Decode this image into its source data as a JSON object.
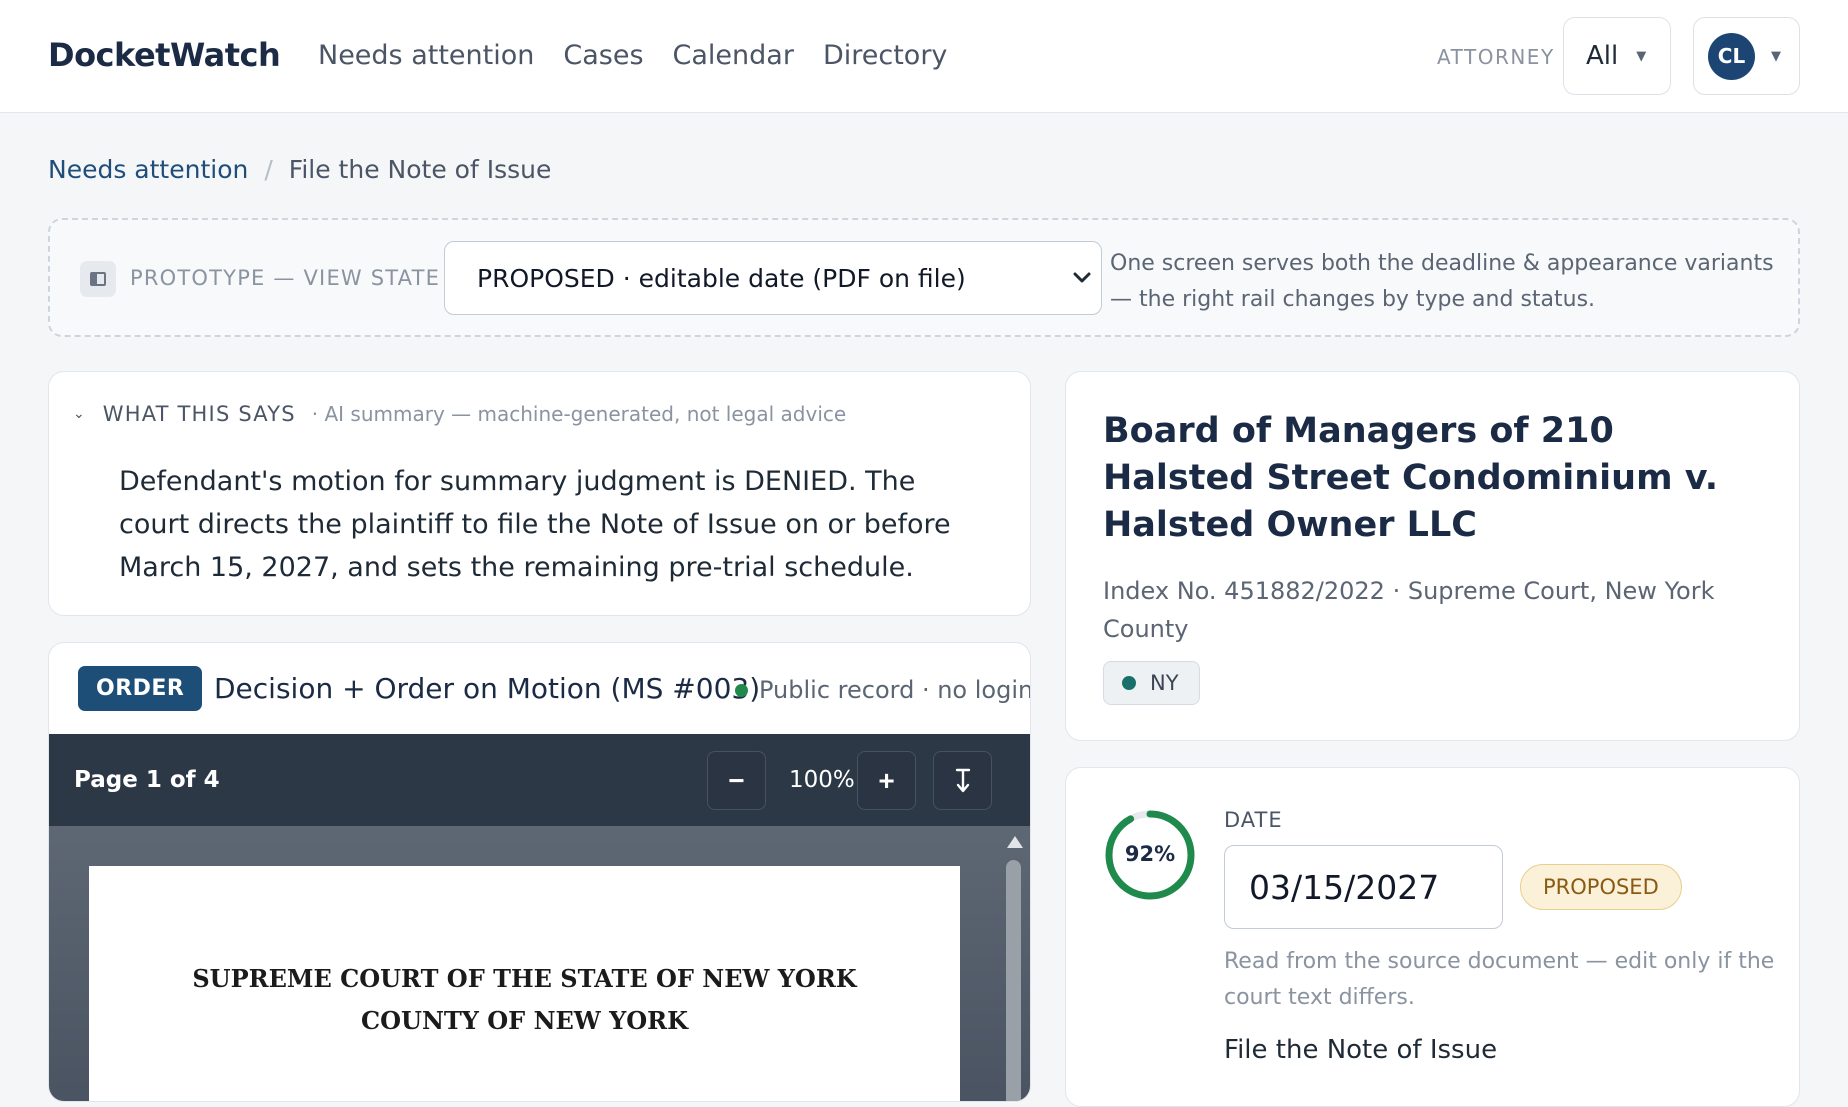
{
  "app": {
    "brand": "DocketWatch"
  },
  "nav": {
    "items": [
      "Needs attention",
      "Cases",
      "Calendar",
      "Directory"
    ]
  },
  "attorney_filter": {
    "label": "ATTORNEY",
    "value": "All"
  },
  "user": {
    "initials": "CL"
  },
  "breadcrumb": {
    "parent": "Needs attention",
    "separator": "/",
    "current": "File the Note of Issue"
  },
  "prototype": {
    "label": "PROTOTYPE — VIEW STATE",
    "selected": "PROPOSED · editable date (PDF on file)",
    "note": "One screen serves both the deadline & appearance variants — the right rail changes by type and status."
  },
  "summary": {
    "title": "WHAT THIS SAYS",
    "subtitle": "· AI summary — machine-generated, not legal advice",
    "body": "Defendant's motion for summary judgment is DENIED. The court directs the plaintiff to file the Note of Issue on or before March 15, 2027, and sets the remaining pre-trial schedule."
  },
  "document": {
    "badge": "ORDER",
    "title": "Decision + Order on Motion (MS #003)",
    "visibility": "Public record · no login",
    "page_indicator": "Page 1 of 4",
    "zoom": "100%",
    "pdf_heading_line1": "SUPREME COURT OF THE STATE OF NEW YORK",
    "pdf_heading_line2": "COUNTY OF NEW YORK"
  },
  "case": {
    "title": "Board of Managers of 210 Halsted Street Condominium v. Halsted Owner LLC",
    "meta": "Index No. 451882/2022 · Supreme Court, New York County",
    "jurisdiction": "NY"
  },
  "deadline": {
    "confidence": 0.92,
    "confidence_label": "92%",
    "label": "DATE",
    "value": "03/15/2027",
    "status": "PROPOSED",
    "help": "Read from the source document — edit only if the court text differs.",
    "task": "File the Note of Issue"
  },
  "colors": {
    "brand_navy": "#1b2b45",
    "accent_blue": "#1d4e78",
    "confidence_green": "#1f8a4c",
    "proposed_amber": "#fbf1d9"
  },
  "icons": {
    "prototype": "panel-icon",
    "zoom_out": "minus-icon",
    "zoom_in": "plus-icon",
    "fit": "fit-height-icon",
    "collapse": "chevron-down-icon"
  }
}
